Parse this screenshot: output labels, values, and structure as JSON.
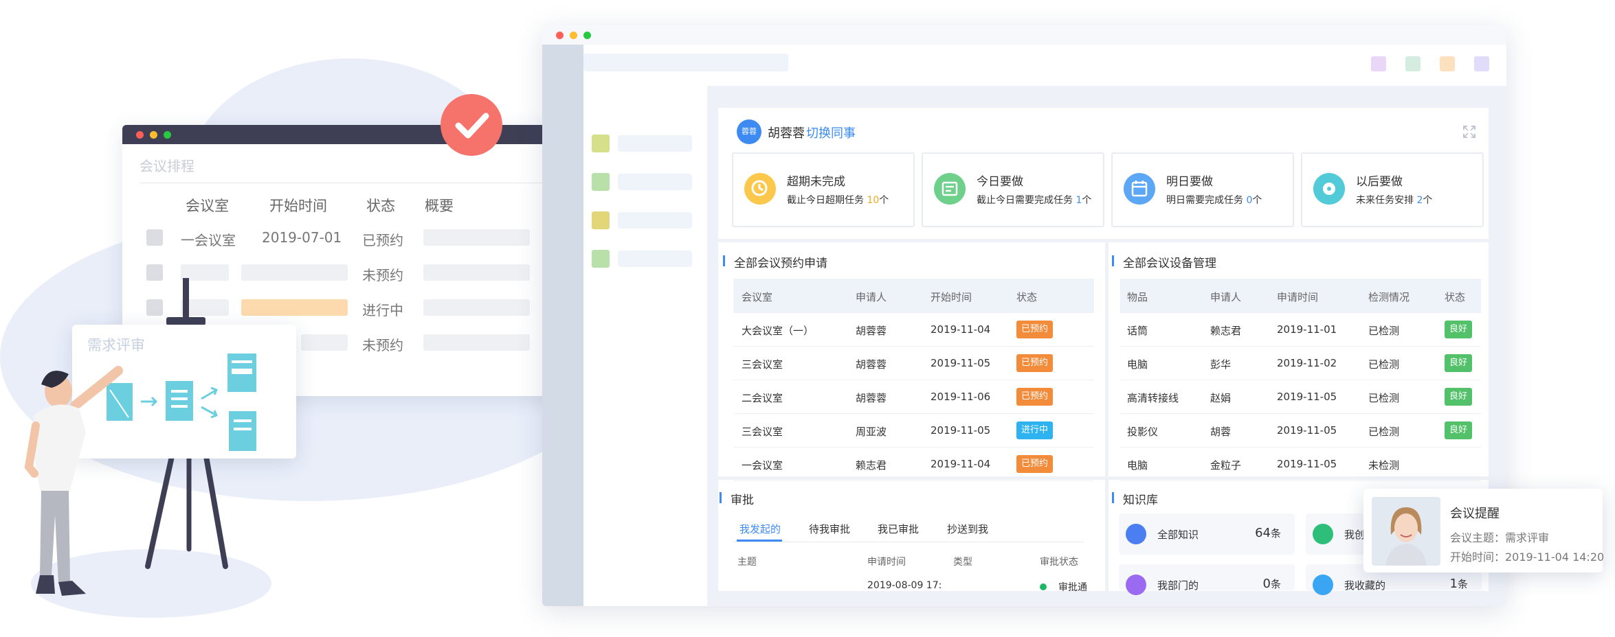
{
  "schedule": {
    "title": "会议排程",
    "headers": [
      "会议室",
      "开始时间",
      "状态",
      "概要"
    ],
    "rows": [
      {
        "room": "一会议室",
        "time": "2019-07-01",
        "status": "已预约"
      },
      {
        "room": "",
        "time": "",
        "status": "未预约"
      },
      {
        "room": "",
        "time": "",
        "status": "进行中"
      },
      {
        "room": "",
        "time": "",
        "status": "未预约"
      }
    ]
  },
  "board": {
    "title": "需求评审"
  },
  "header": {
    "avatar_text": "蓉蓉",
    "user_name": "胡蓉蓉",
    "switch_label": "切换同事"
  },
  "cards": [
    {
      "title": "超期未完成",
      "sub_prefix": "截止今日超期任务",
      "count": "10",
      "unit": "个",
      "accent": "#f5a623"
    },
    {
      "title": "今日要做",
      "sub_prefix": "截止今日需要完成任务",
      "count": "1",
      "unit": "个",
      "accent": "#3d8bf2"
    },
    {
      "title": "明日要做",
      "sub_prefix": "明日需要完成任务",
      "count": "0",
      "unit": "个",
      "accent": "#3d8bf2"
    },
    {
      "title": "以后要做",
      "sub_prefix": "未来任务安排",
      "count": "2",
      "unit": "个",
      "accent": "#3d8bf2"
    }
  ],
  "booking": {
    "title": "全部会议预约申请",
    "headers": [
      "会议室",
      "申请人",
      "开始时间",
      "状态"
    ],
    "rows": [
      {
        "room": "大会议室（一）",
        "applicant": "胡蓉蓉",
        "time": "2019-11-04",
        "status": "已预约"
      },
      {
        "room": "三会议室",
        "applicant": "胡蓉蓉",
        "time": "2019-11-05",
        "status": "已预约"
      },
      {
        "room": "二会议室",
        "applicant": "胡蓉蓉",
        "time": "2019-11-06",
        "status": "已预约"
      },
      {
        "room": "三会议室",
        "applicant": "周亚波",
        "time": "2019-11-05",
        "status": "进行中"
      },
      {
        "room": "一会议室",
        "applicant": "赖志君",
        "time": "2019-11-04",
        "status": "已预约"
      }
    ]
  },
  "equipment": {
    "title": "全部会议设备管理",
    "headers": [
      "物品",
      "申请人",
      "申请时间",
      "检测情况",
      "状态"
    ],
    "rows": [
      {
        "item": "话筒",
        "applicant": "赖志君",
        "time": "2019-11-01",
        "check": "已检测",
        "status": "良好"
      },
      {
        "item": "电脑",
        "applicant": "彭华",
        "time": "2019-11-02",
        "check": "已检测",
        "status": "良好"
      },
      {
        "item": "高清转接线",
        "applicant": "赵娟",
        "time": "2019-11-05",
        "check": "已检测",
        "status": "良好"
      },
      {
        "item": "投影仪",
        "applicant": "胡蓉",
        "time": "2019-11-05",
        "check": "已检测",
        "status": "良好"
      },
      {
        "item": "电脑",
        "applicant": "金粒子",
        "time": "2019-11-05",
        "check": "未检测",
        "status": ""
      }
    ]
  },
  "approval": {
    "title": "审批",
    "tabs": [
      "我发起的",
      "待我审批",
      "我已审批",
      "抄送到我"
    ],
    "headers": [
      "主题",
      "申请时间",
      "类型",
      "审批状态"
    ],
    "row": {
      "time": "2019-08-09 17:",
      "status": "审批通"
    }
  },
  "knowledge": {
    "title": "知识库",
    "items": [
      {
        "label": "全部知识",
        "count": "64",
        "unit": "条"
      },
      {
        "label": "我创",
        "count": "",
        "unit": ""
      },
      {
        "label": "我部门的",
        "count": "0",
        "unit": "条"
      },
      {
        "label": "我收藏的",
        "count": "1",
        "unit": "条"
      }
    ]
  },
  "notification": {
    "title": "会议提醒",
    "topic": "会议主题：需求评审",
    "start": "开始时间：2019-11-04 14:20"
  },
  "colors": {
    "accent": "#3d8bf2",
    "booked": "#f28b3a",
    "in_progress": "#2fb3f0",
    "good": "#52c16a",
    "check_badge": "#f5736a"
  }
}
